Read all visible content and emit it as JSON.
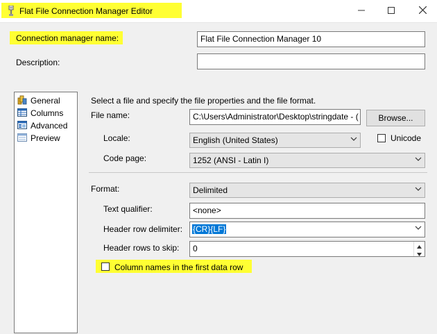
{
  "window": {
    "title": "Flat File Connection Manager Editor"
  },
  "header": {
    "conn_name_label": "Connection manager name:",
    "conn_name_value": "Flat File Connection Manager 10",
    "description_label": "Description:",
    "description_value": ""
  },
  "nav": {
    "items": [
      "General",
      "Columns",
      "Advanced",
      "Preview"
    ],
    "selected": "General"
  },
  "general": {
    "intro": "Select a file and specify the file properties and the file format.",
    "file_name_label": "File name:",
    "file_name_value": "C:\\Users\\Administrator\\Desktop\\stringdate - (",
    "browse_label": "Browse...",
    "locale_label": "Locale:",
    "locale_value": "English (United States)",
    "unicode_label": "Unicode",
    "code_page_label": "Code page:",
    "code_page_value": "1252  (ANSI - Latin I)",
    "format_label": "Format:",
    "format_value": "Delimited",
    "text_qualifier_label": "Text qualifier:",
    "text_qualifier_value": "<none>",
    "header_delim_label": "Header row delimiter:",
    "header_delim_value": "{CR}{LF}",
    "header_skip_label": "Header rows to skip:",
    "header_skip_value": "0",
    "column_names_label": "Column names in the first data row"
  },
  "colors": {
    "highlight": "#ffff33",
    "selection": "#0078d7"
  }
}
